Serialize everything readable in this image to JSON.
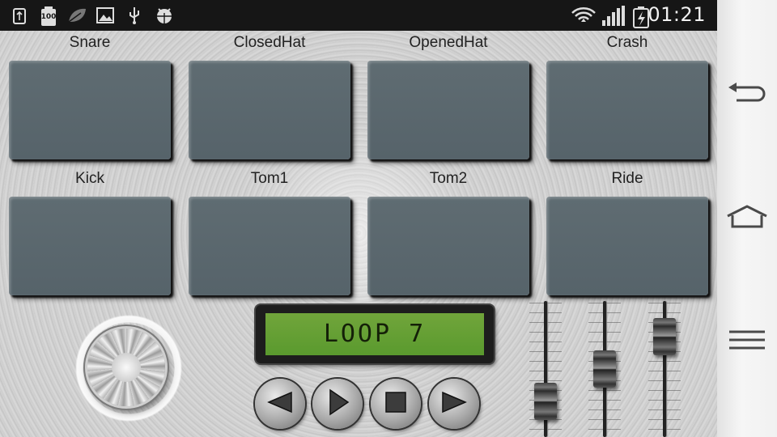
{
  "status_bar": {
    "icons": [
      "usb-icon",
      "battery-full-icon",
      "leaf-icon",
      "image-icon",
      "usb-debug-icon",
      "android-debug-icon",
      "wifi-icon",
      "signal-icon",
      "battery-charging-icon"
    ],
    "battery_label": "100",
    "clock": "01:21"
  },
  "pads": [
    {
      "label": "Snare"
    },
    {
      "label": "ClosedHat"
    },
    {
      "label": "OpenedHat"
    },
    {
      "label": "Crash"
    },
    {
      "label": "Kick"
    },
    {
      "label": "Tom1"
    },
    {
      "label": "Tom2"
    },
    {
      "label": "Ride"
    }
  ],
  "display": {
    "text": "LOOP 7"
  },
  "transport": [
    "previous-icon",
    "play-icon",
    "stop-icon",
    "next-icon"
  ],
  "faders": [
    {
      "level": 0.15
    },
    {
      "level": 0.5
    },
    {
      "level": 0.85
    }
  ],
  "nav_bar": [
    "back-icon",
    "home-icon",
    "menu-icon"
  ],
  "colors": {
    "pad": "#5a666c",
    "lcd": "#64a032",
    "status_bar": "#161616"
  }
}
